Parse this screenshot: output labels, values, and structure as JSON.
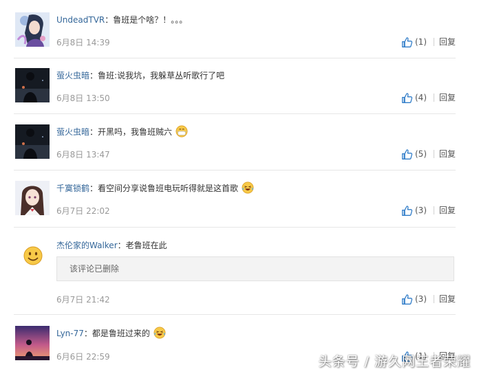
{
  "colors": {
    "username": "#336699",
    "text": "#333333",
    "meta": "#999999",
    "deleted_bg": "#f3f3f3"
  },
  "comments": [
    {
      "user": "UndeadTVR",
      "sep": "：",
      "text": "鲁班是个啥？！。。。",
      "emoji": "",
      "time": "6月8日 14:39",
      "likes": "(1)",
      "reply": "回复",
      "avatar_icon": "anime-girl-avatar"
    },
    {
      "user": "萤火虫暗",
      "sep": "：",
      "text": "鲁班:说我坑，我躲草丛听歌行了吧",
      "emoji": "",
      "time": "6月8日 13:50",
      "likes": "(4)",
      "reply": "回复",
      "avatar_icon": "dark-silhouette-avatar"
    },
    {
      "user": "萤火虫暗",
      "sep": "：",
      "text": "开黑吗，我鲁班贼六",
      "emoji": "mask-emoji",
      "time": "6月8日 13:47",
      "likes": "(5)",
      "reply": "回复",
      "avatar_icon": "dark-silhouette-avatar"
    },
    {
      "user": "千寞锁鹤",
      "sep": "：",
      "text": "看空间分享说鲁班电玩听得就是这首歌",
      "emoji": "laugh-cry-emoji",
      "time": "6月7日 22:02",
      "likes": "(3)",
      "reply": "回复",
      "avatar_icon": "anime-schoolgirl-avatar"
    },
    {
      "user": "杰伦家的Walker",
      "sep": "：",
      "text": "老鲁班在此",
      "emoji": "",
      "deleted_text": "该评论已删除",
      "time": "6月7日 21:42",
      "likes": "(3)",
      "reply": "回复",
      "avatar_icon": "smiley-emoji-avatar"
    },
    {
      "user": "Lyn-77",
      "sep": "：",
      "text": "都是鲁班过来的",
      "emoji": "laugh-cry-emoji",
      "time": "6月6日 22:59",
      "likes": "(1)",
      "reply": "回复",
      "avatar_icon": "sunset-silhouette-avatar"
    }
  ],
  "watermark": "头条号 / 游久网王者荣耀"
}
